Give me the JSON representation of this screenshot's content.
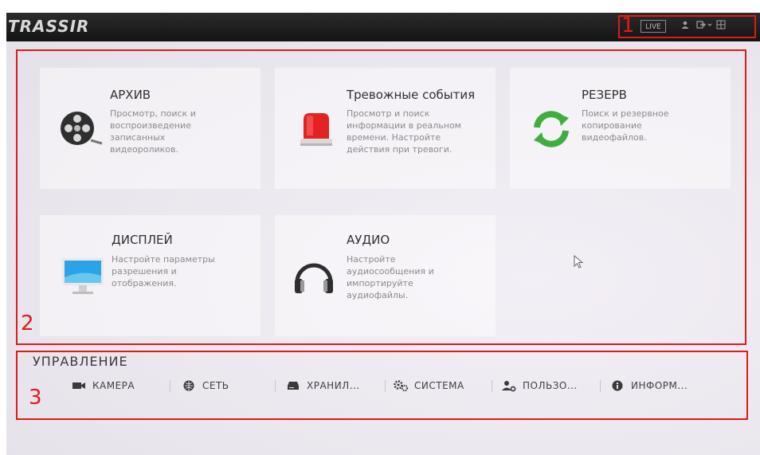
{
  "topbar": {
    "logo": "TRASSIR",
    "live_label": "LIVE"
  },
  "annotations": [
    "1",
    "2",
    "3"
  ],
  "tiles": [
    {
      "title": "АРХИВ",
      "desc": "Просмотр, поиск и\nвоспроизведение\nзаписанных\nвидеороликов.",
      "icon": "film-reel-icon"
    },
    {
      "title": "Тревожные события",
      "desc": "Просмотр и поиск\nинформации в реальном\nвремени. Настройте\nдействия при тревоги.",
      "icon": "alarm-siren-icon"
    },
    {
      "title": "РЕЗЕРВ",
      "desc": "Поиск и резервное\nкопирование\nвидеофайлов.",
      "icon": "sync-arrows-icon"
    },
    {
      "title": "ДИСПЛЕЙ",
      "desc": "Настройте параметры\nразрешения и\nотображения.",
      "icon": "monitor-icon"
    },
    {
      "title": "АУДИО",
      "desc": "Настройте\nаудиосообщения и\nимпортируйте\nаудиофайлы.",
      "icon": "headphones-icon"
    }
  ],
  "management": {
    "title": "УПРАВЛЕНИЕ",
    "items": [
      {
        "label": "КАМЕРА",
        "icon": "camera-icon"
      },
      {
        "label": "СЕТЬ",
        "icon": "network-icon"
      },
      {
        "label": "ХРАНИЛ...",
        "icon": "storage-icon"
      },
      {
        "label": "СИСТЕМА",
        "icon": "gears-icon"
      },
      {
        "label": "ПОЛЬЗО...",
        "icon": "users-icon"
      },
      {
        "label": "ИНФОРМ...",
        "icon": "info-icon"
      }
    ]
  },
  "colors": {
    "annotation": "#e01a1a",
    "topbar": "#1e1e1e",
    "alarm": "#e52222",
    "sync": "#3fae3f"
  }
}
